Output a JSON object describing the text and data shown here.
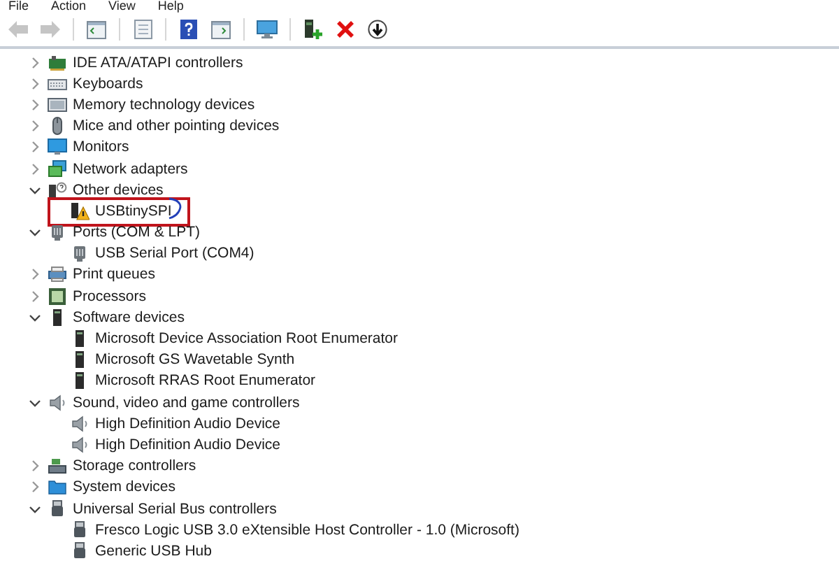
{
  "menu": [
    {
      "label": "File"
    },
    {
      "label": "Action"
    },
    {
      "label": "View"
    },
    {
      "label": "Help"
    }
  ],
  "toolbar": [
    {
      "kind": "back",
      "disabled": true
    },
    {
      "kind": "forward",
      "disabled": true
    },
    {
      "kind": "separator"
    },
    {
      "kind": "console",
      "disabled": false
    },
    {
      "kind": "separator"
    },
    {
      "kind": "properties",
      "disabled": false
    },
    {
      "kind": "separator"
    },
    {
      "kind": "help",
      "disabled": false
    },
    {
      "kind": "action-pane",
      "disabled": false
    },
    {
      "kind": "separator"
    },
    {
      "kind": "scan",
      "disabled": false
    },
    {
      "kind": "separator"
    },
    {
      "kind": "add-driver",
      "disabled": false
    },
    {
      "kind": "uninstall",
      "disabled": false
    },
    {
      "kind": "download",
      "disabled": false
    }
  ],
  "tree": [
    {
      "label": "IDE ATA/ATAPI controllers",
      "kind": "ide",
      "expanded": false
    },
    {
      "label": "Keyboards",
      "kind": "keyboard",
      "expanded": false
    },
    {
      "label": "Memory technology devices",
      "kind": "memory",
      "expanded": false
    },
    {
      "label": "Mice and other pointing devices",
      "kind": "mouse",
      "expanded": false
    },
    {
      "label": "Monitors",
      "kind": "monitor",
      "expanded": false
    },
    {
      "label": "Network adapters",
      "kind": "network",
      "expanded": false
    },
    {
      "label": "Other devices",
      "kind": "other",
      "expanded": true,
      "children": [
        {
          "label": "USBtinySPI",
          "kind": "warning",
          "highlighted": true
        }
      ]
    },
    {
      "label": "Ports (COM & LPT)",
      "kind": "port",
      "expanded": true,
      "children": [
        {
          "label": "USB Serial Port (COM4)",
          "kind": "port",
          "highlighted": false
        }
      ]
    },
    {
      "label": "Print queues",
      "kind": "printer",
      "expanded": false
    },
    {
      "label": "Processors",
      "kind": "cpu",
      "expanded": false
    },
    {
      "label": "Software devices",
      "kind": "software",
      "expanded": true,
      "children": [
        {
          "label": "Microsoft Device Association Root Enumerator",
          "kind": "software",
          "highlighted": false
        },
        {
          "label": "Microsoft GS Wavetable Synth",
          "kind": "software",
          "highlighted": false
        },
        {
          "label": "Microsoft RRAS Root Enumerator",
          "kind": "software",
          "highlighted": false
        }
      ]
    },
    {
      "label": "Sound, video and game controllers",
      "kind": "speaker",
      "expanded": true,
      "children": [
        {
          "label": "High Definition Audio Device",
          "kind": "speaker",
          "highlighted": false
        },
        {
          "label": "High Definition Audio Device",
          "kind": "speaker",
          "highlighted": false
        }
      ]
    },
    {
      "label": "Storage controllers",
      "kind": "storage",
      "expanded": false
    },
    {
      "label": "System devices",
      "kind": "folder",
      "expanded": false
    },
    {
      "label": "Universal Serial Bus controllers",
      "kind": "usb",
      "expanded": true,
      "children": [
        {
          "label": "Fresco Logic USB 3.0 eXtensible Host Controller - 1.0 (Microsoft)",
          "kind": "usb",
          "highlighted": false
        },
        {
          "label": "Generic USB Hub",
          "kind": "usb",
          "highlighted": false
        }
      ]
    }
  ]
}
